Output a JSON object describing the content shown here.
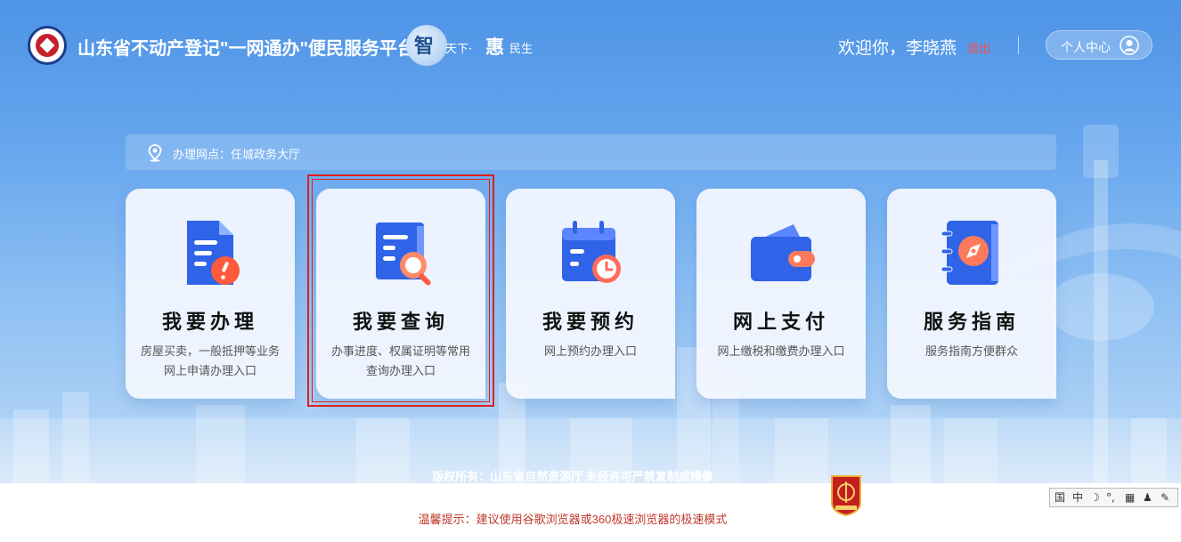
{
  "header": {
    "site_title": "山东省不动产登记\"一网通办\"便民服务平台",
    "slogan": {
      "zhi": "智",
      "tianxia": "天下·",
      "hui": "惠",
      "minsheng": "民生"
    },
    "welcome": "欢迎你，李晓燕",
    "logout": "退出",
    "personal_center": "个人中心"
  },
  "location": {
    "label": "办理网点：任城政务大厅"
  },
  "cards": [
    {
      "title": "我要办理",
      "desc": "房屋买卖，一般抵押等业务网上申请办理入口",
      "icon": "document-alert-icon"
    },
    {
      "title": "我要查询",
      "desc": "办事进度、权属证明等常用查询办理入口",
      "icon": "document-search-icon"
    },
    {
      "title": "我要预约",
      "desc": "网上预约办理入口",
      "icon": "calendar-clock-icon"
    },
    {
      "title": "网上支付",
      "desc": "网上缴税和缴费办理入口",
      "icon": "wallet-icon"
    },
    {
      "title": "服务指南",
      "desc": "服务指南方便群众",
      "icon": "compass-book-icon"
    }
  ],
  "footer": {
    "copyright": "版权所有：山东省自然资源厅 未经许可严禁复制或镜像",
    "tip": "温馨提示：建议使用谷歌浏览器或360极速浏览器的极速模式"
  },
  "ime_bar": {
    "items": [
      "国",
      "中",
      "☽",
      "°,",
      "▦",
      "♟",
      "✎"
    ]
  },
  "colors": {
    "accent_blue": "#2f63e8",
    "accent_orange": "#ff5a3c",
    "highlight_red": "#e0201b",
    "tip_red": "#c0392b",
    "logout_red": "#ff4a4a"
  }
}
